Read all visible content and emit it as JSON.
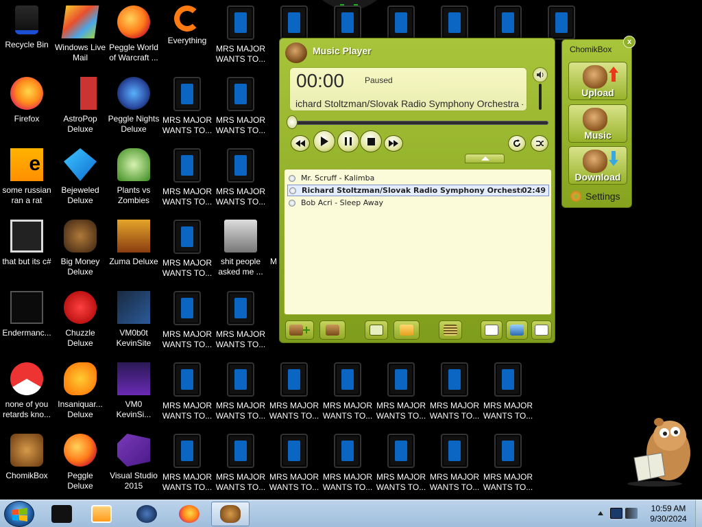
{
  "desktop": {
    "icons": [
      {
        "label": "Recycle Bin",
        "icon": "recycle-bin-icon"
      },
      {
        "label": "Windows Live Mail",
        "icon": "windows-live-mail-icon"
      },
      {
        "label": "Peggle World of Warcraft ...",
        "icon": "peggle-icon"
      },
      {
        "label": "Everything",
        "icon": "everything-icon"
      },
      {
        "label": "MRS MAJOR WANTS TO...",
        "icon": "tablet-icon"
      },
      {
        "label": "Firefox",
        "icon": "firefox-icon"
      },
      {
        "label": "AstroPop Deluxe",
        "icon": "astropop-icon"
      },
      {
        "label": "Peggle Nights Deluxe",
        "icon": "peggle-nights-icon"
      },
      {
        "label": "some russian ran a rat",
        "icon": "rat-icon"
      },
      {
        "label": "Bejeweled Deluxe",
        "icon": "bejeweled-icon"
      },
      {
        "label": "Plants vs Zombies",
        "icon": "plants-vs-zombies-icon"
      },
      {
        "label": "that but its c#",
        "icon": "windows-icon"
      },
      {
        "label": "Big Money Deluxe",
        "icon": "big-money-icon"
      },
      {
        "label": "Zuma Deluxe",
        "icon": "zuma-icon"
      },
      {
        "label": "shit people asked me ...",
        "icon": "folder-icon"
      },
      {
        "label": "Endermanc...",
        "icon": "enderman-icon"
      },
      {
        "label": "Chuzzle Deluxe",
        "icon": "chuzzle-icon"
      },
      {
        "label": "VM0b0t KevinSite",
        "icon": "vm-icon"
      },
      {
        "label": "none of you retards kno...",
        "icon": "chrome-icon"
      },
      {
        "label": "Insaniquar... Deluxe",
        "icon": "insaniquarium-icon"
      },
      {
        "label": "VM0 KevinSi...",
        "icon": "vm-icon"
      },
      {
        "label": "ChomikBox",
        "icon": "chomikbox-icon"
      },
      {
        "label": "Peggle Deluxe",
        "icon": "peggle-icon"
      },
      {
        "label": "Visual Studio 2015",
        "icon": "visual-studio-icon"
      },
      {
        "label": "M",
        "icon": "tablet-icon"
      }
    ],
    "repeated_label": "MRS MAJOR WANTS TO..."
  },
  "player": {
    "title": "Music Player",
    "time": "00:00",
    "status": "Paused",
    "track": "ichard Stoltzman/Slovak Radio Symphony Orchestra -",
    "progress": 0,
    "playlist": [
      {
        "title": "Mr. Scruff - Kalimba",
        "duration": ""
      },
      {
        "title": "Richard Stoltzman/Slovak Radio Symphony Orchestra - ...",
        "duration": "02:49",
        "selected": true
      },
      {
        "title": "Bob Acri - Sleep Away",
        "duration": ""
      }
    ]
  },
  "chomikbox": {
    "title": "ChomikBox",
    "close": "x",
    "upload": "Upload",
    "music": "Music",
    "download": "Download",
    "settings": "Settings"
  },
  "taskbar": {
    "time": "10:59 AM",
    "date": "9/30/2024"
  },
  "colors": {
    "player_green": "#a8c43a",
    "lcd": "#f6f8c2",
    "taskbar": "#bcd3ea",
    "tablet_blue": "#0a66c2"
  }
}
